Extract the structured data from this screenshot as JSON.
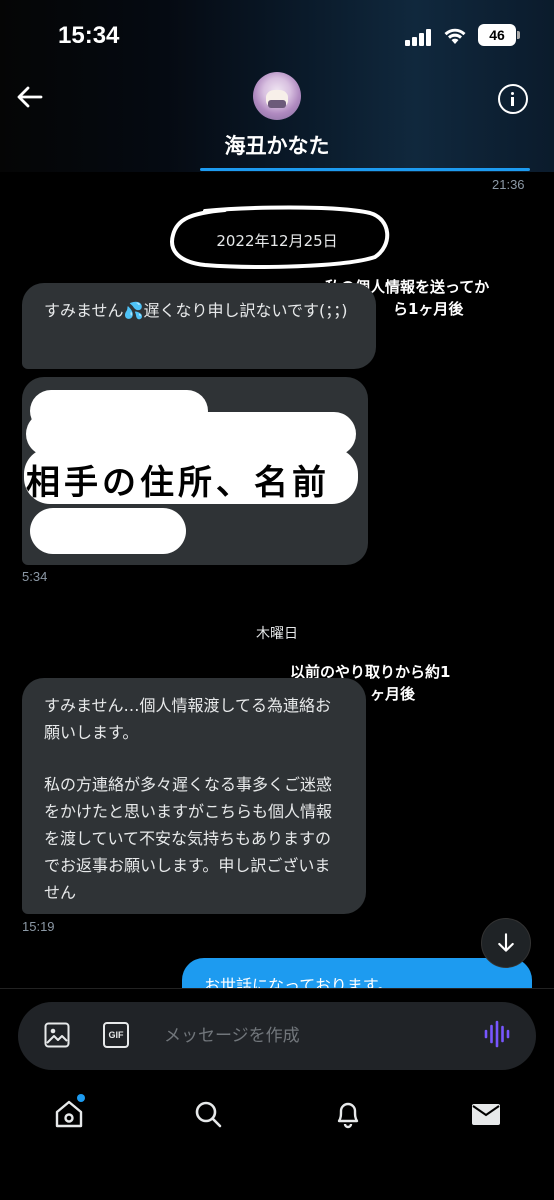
{
  "status_bar": {
    "time": "15:34",
    "battery": "46"
  },
  "header": {
    "contact_name": "海丑かなた"
  },
  "messages": {
    "top_time": "21:36",
    "date_divider": "2022年12月25日",
    "msg1": {
      "text": "すみません💦遅くなり申し訳ないです(；；)"
    },
    "msg2": {
      "overlay_text": "相手の住所、名前",
      "time": "5:34"
    },
    "day_divider": "木曜日",
    "msg3": {
      "line1": "すみません…個人情報渡してる為連絡お願いします。",
      "line2": "私の方連絡が多々遅くなる事多くご迷惑をかけたと思いますがこちらも個人情報を渡していて不安な気持ちもありますのでお返事お願いします。申し訳ございません",
      "time": "15:19"
    },
    "outgoing_preview": "お世話になっております。"
  },
  "annotations": {
    "note1_line1": "私の個人情報を送ってか",
    "note1_line2": "ら1ヶ月後",
    "note2_line1": "以前のやり取りから約1",
    "note2_line2": "ヶ月後"
  },
  "composer": {
    "placeholder": "メッセージを作成"
  },
  "colors": {
    "accent": "#1d9bf0",
    "bubble_in": "#2f3336",
    "voice": "#7856ff"
  }
}
